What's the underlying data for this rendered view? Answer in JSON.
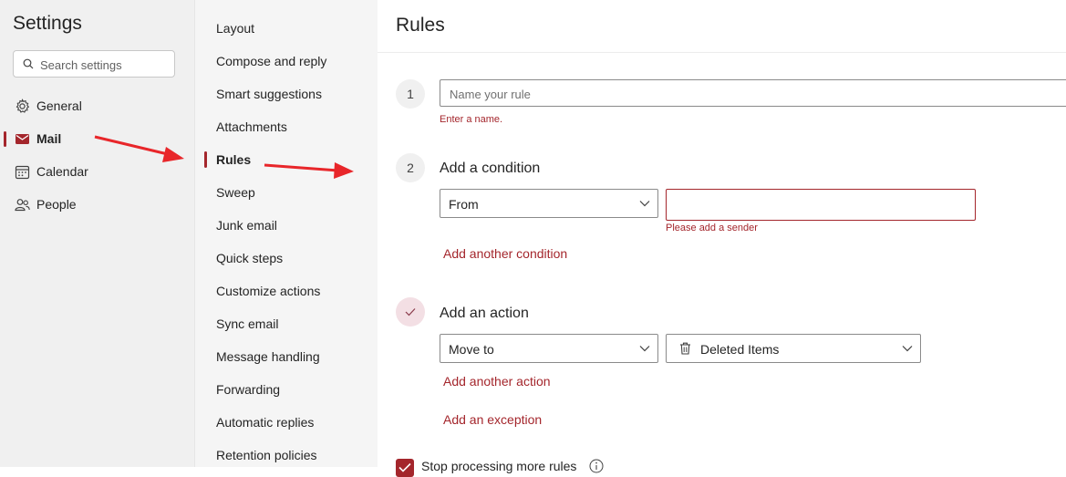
{
  "left_pane": {
    "title": "Settings",
    "search_placeholder": "Search settings",
    "items": [
      {
        "label": "General",
        "icon": "gear-icon"
      },
      {
        "label": "Mail",
        "icon": "mail-icon",
        "active": true
      },
      {
        "label": "Calendar",
        "icon": "calendar-icon"
      },
      {
        "label": "People",
        "icon": "people-icon"
      }
    ]
  },
  "mid_pane": {
    "items": [
      "Layout",
      "Compose and reply",
      "Smart suggestions",
      "Attachments",
      "Rules",
      "Sweep",
      "Junk email",
      "Quick steps",
      "Customize actions",
      "Sync email",
      "Message handling",
      "Forwarding",
      "Automatic replies",
      "Retention policies"
    ],
    "active_index": 4
  },
  "rules": {
    "title": "Rules",
    "step1": {
      "number": "1",
      "name_placeholder": "Name your rule",
      "error": "Enter a name."
    },
    "step2": {
      "number": "2",
      "heading": "Add a condition",
      "condition_dropdown": "From",
      "sender_error": "Please add a sender",
      "add_condition_link": "Add another condition"
    },
    "step3": {
      "heading": "Add an action",
      "action_dropdown": "Move to",
      "folder_dropdown": "Deleted Items",
      "folder_icon": "trash-icon",
      "add_action_link": "Add another action",
      "add_exception_link": "Add an exception"
    },
    "stop_processing": {
      "label": "Stop processing more rules",
      "checked": true
    }
  },
  "colors": {
    "accent": "#a4262c",
    "annotation_arrow": "#e8262a"
  }
}
